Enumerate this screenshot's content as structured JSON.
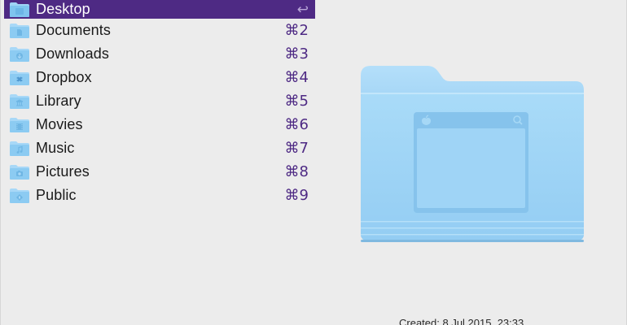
{
  "items": [
    {
      "label": "Desktop",
      "shortcut": "↩",
      "icon": "desktop-folder-icon",
      "selected": true
    },
    {
      "label": "Documents",
      "shortcut": "⌘2",
      "icon": "documents-folder-icon"
    },
    {
      "label": "Downloads",
      "shortcut": "⌘3",
      "icon": "downloads-folder-icon"
    },
    {
      "label": "Dropbox",
      "shortcut": "⌘4",
      "icon": "dropbox-folder-icon"
    },
    {
      "label": "Library",
      "shortcut": "⌘5",
      "icon": "library-folder-icon"
    },
    {
      "label": "Movies",
      "shortcut": "⌘6",
      "icon": "movies-folder-icon"
    },
    {
      "label": "Music",
      "shortcut": "⌘7",
      "icon": "music-folder-icon"
    },
    {
      "label": "Pictures",
      "shortcut": "⌘8",
      "icon": "pictures-folder-icon"
    },
    {
      "label": "Public",
      "shortcut": "⌘9",
      "icon": "public-folder-icon"
    }
  ],
  "preview": {
    "icon": "desktop-folder-large-icon",
    "created": "Created: 8 Jul 2015, 23:33"
  },
  "colors": {
    "selection": "#4e2a84",
    "shortcut": "#4e2a84",
    "folder_light": "#a8d8f7",
    "folder_mid": "#8ccbf2"
  }
}
